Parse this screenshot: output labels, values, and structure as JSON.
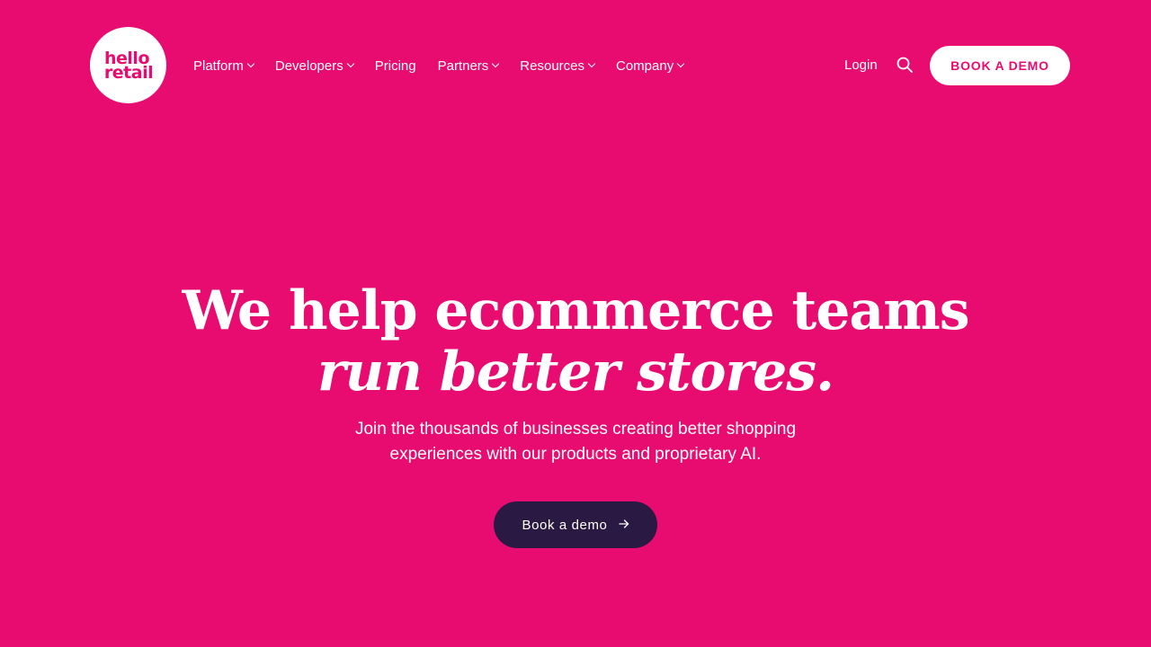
{
  "brand": {
    "logo_line1": "hello",
    "logo_line2": "retail",
    "primary_color": "#E80B70",
    "dark_color": "#2A1943"
  },
  "nav": {
    "items": [
      {
        "label": "Platform",
        "has_dropdown": true
      },
      {
        "label": "Developers",
        "has_dropdown": true
      },
      {
        "label": "Pricing",
        "has_dropdown": false
      },
      {
        "label": "Partners",
        "has_dropdown": true
      },
      {
        "label": "Resources",
        "has_dropdown": true
      },
      {
        "label": "Company",
        "has_dropdown": true
      }
    ],
    "login_label": "Login",
    "search_icon": "search-icon",
    "cta_label": "BOOK A DEMO"
  },
  "hero": {
    "title_line1": "We help ecommerce teams",
    "title_line2": "run better stores.",
    "subtitle_line1": "Join the thousands of businesses creating better shopping",
    "subtitle_line2": "experiences with our products and proprietary AI.",
    "cta_label": "Book a demo",
    "cta_icon": "arrow-right-icon"
  }
}
